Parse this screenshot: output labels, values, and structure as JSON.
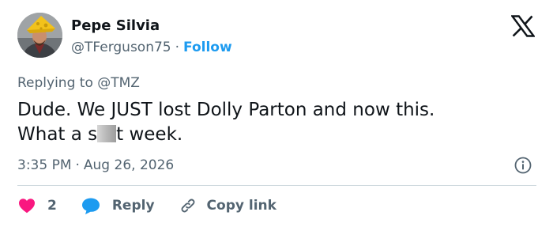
{
  "author": {
    "name": "Pepe Silvia",
    "handle": "@TFerguson75",
    "separator": "·",
    "follow_label": "Follow"
  },
  "reply_context": {
    "prefix": "Replying to",
    "mention": "@TMZ"
  },
  "tweet": {
    "line1": "Dude. We JUST lost Dolly Parton and now this.",
    "line2_before": "What a s",
    "line2_after": "t week."
  },
  "meta": {
    "time": "3:35 PM",
    "separator": "·",
    "date": "Aug 26, 2026"
  },
  "actions": {
    "like_count": "2",
    "reply_label": "Reply",
    "copy_label": "Copy link"
  },
  "colors": {
    "accent": "#1d9bf0",
    "like": "#f91880",
    "text": "#0f1419",
    "secondary": "#536471",
    "divider": "#cfd9de"
  },
  "icons": {
    "logo": "x-logo-icon",
    "info": "info-icon",
    "like": "heart-icon",
    "reply": "speech-bubble-icon",
    "copy": "link-icon"
  }
}
